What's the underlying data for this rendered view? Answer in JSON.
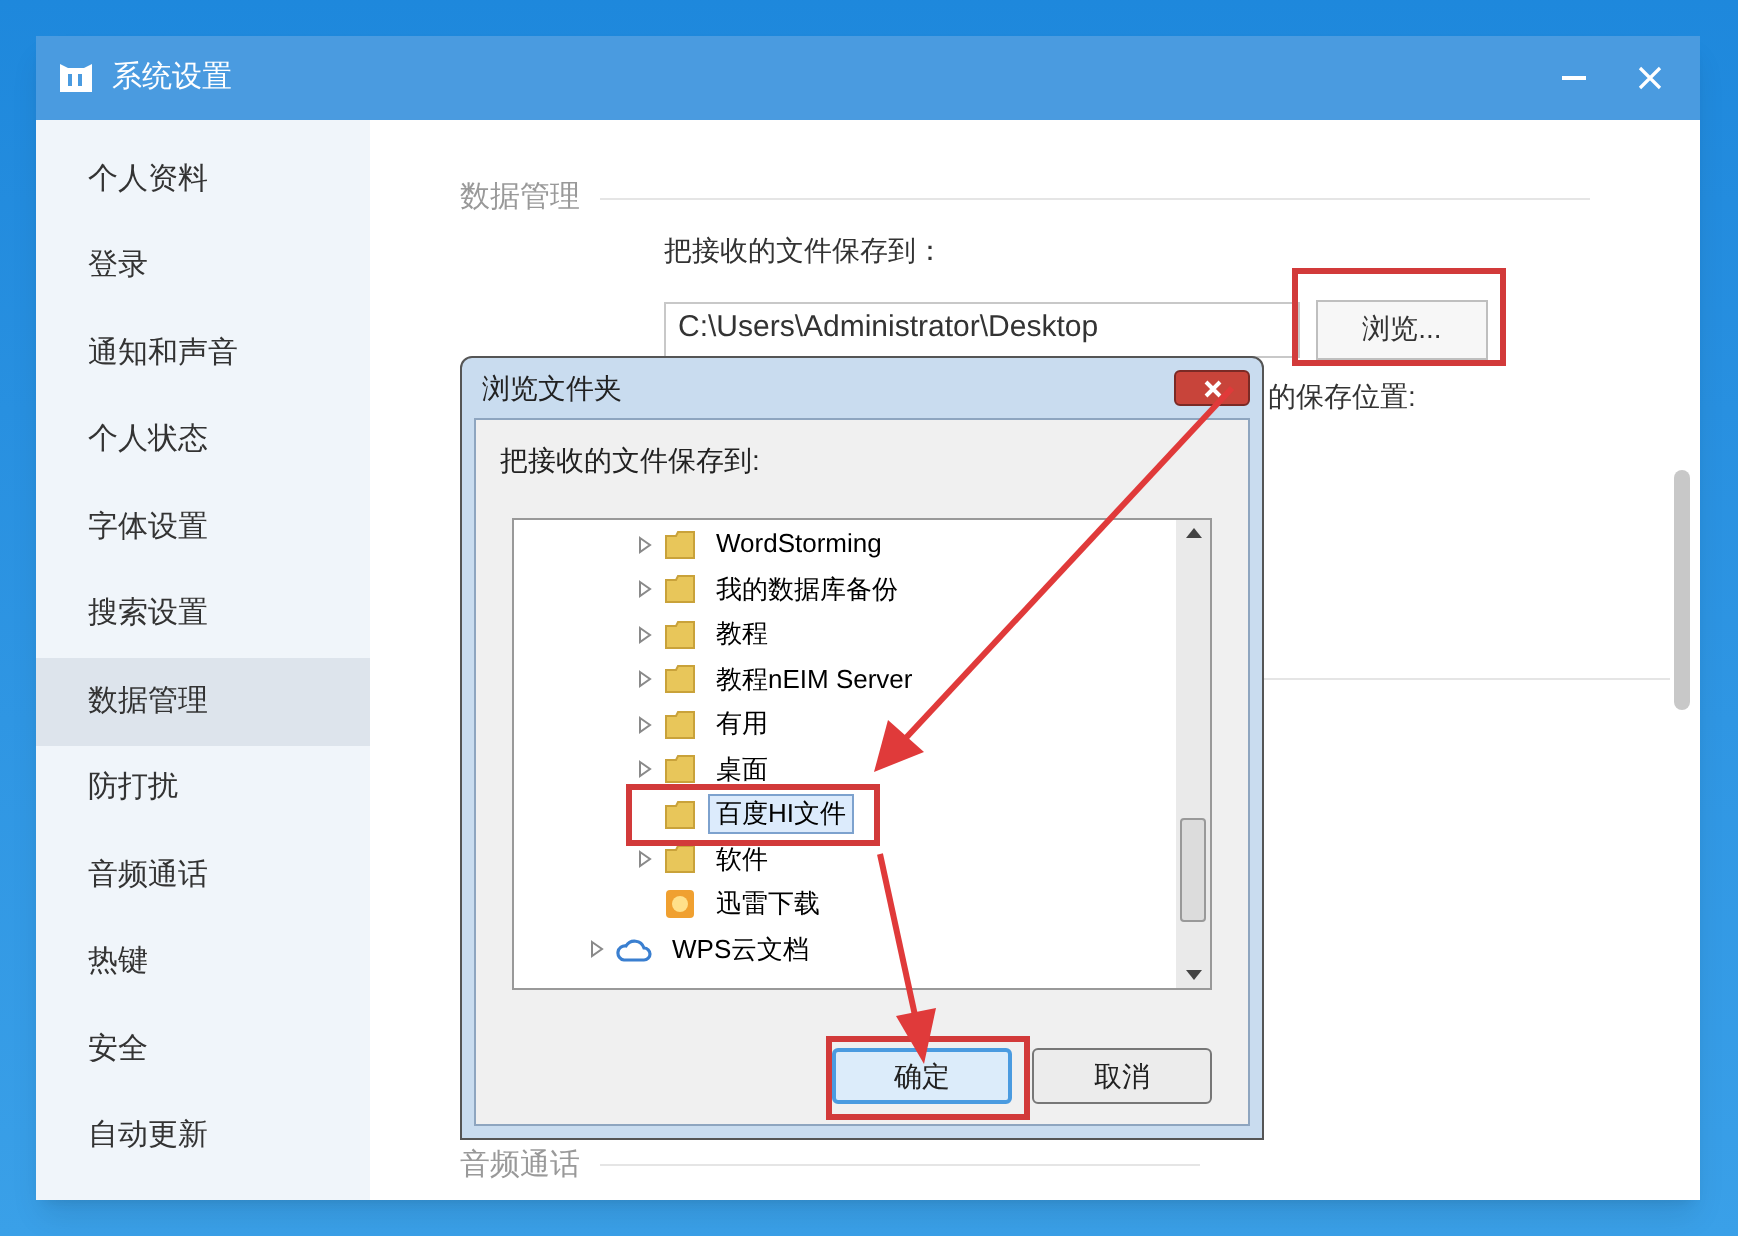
{
  "window": {
    "title": "系统设置"
  },
  "sidebar": {
    "items": [
      {
        "label": "个人资料",
        "selected": false
      },
      {
        "label": "登录",
        "selected": false
      },
      {
        "label": "通知和声音",
        "selected": false
      },
      {
        "label": "个人状态",
        "selected": false
      },
      {
        "label": "字体设置",
        "selected": false
      },
      {
        "label": "搜索设置",
        "selected": false
      },
      {
        "label": "数据管理",
        "selected": true
      },
      {
        "label": "防打扰",
        "selected": false
      },
      {
        "label": "音频通话",
        "selected": false
      },
      {
        "label": "热键",
        "selected": false
      },
      {
        "label": "安全",
        "selected": false
      },
      {
        "label": "自动更新",
        "selected": false
      }
    ]
  },
  "content": {
    "section_title": "数据管理",
    "save_label": "把接收的文件保存到：",
    "path_field": {
      "value": "C:\\Users\\Administrator\\Desktop"
    },
    "browse_button": "浏览...",
    "hidden_text_fragment": "的保存位置:",
    "next_section_title": "音频通话"
  },
  "dialog": {
    "title": "浏览文件夹",
    "prompt": "把接收的文件保存到:",
    "tree": {
      "subfolders": [
        {
          "label": "WordStorming",
          "kind": "folder",
          "expandable": true,
          "selected": false
        },
        {
          "label": "我的数据库备份",
          "kind": "folder",
          "expandable": true,
          "selected": false
        },
        {
          "label": "教程",
          "kind": "folder",
          "expandable": true,
          "selected": false
        },
        {
          "label": "教程nEIM Server",
          "kind": "folder",
          "expandable": true,
          "selected": false
        },
        {
          "label": "有用",
          "kind": "folder",
          "expandable": true,
          "selected": false
        },
        {
          "label": "桌面",
          "kind": "folder",
          "expandable": true,
          "selected": false
        },
        {
          "label": "百度HI文件",
          "kind": "folder",
          "expandable": false,
          "selected": true
        },
        {
          "label": "软件",
          "kind": "folder",
          "expandable": true,
          "selected": false
        },
        {
          "label": "迅雷下载",
          "kind": "download",
          "expandable": false,
          "selected": false
        }
      ],
      "top_level": [
        {
          "label": "WPS云文档",
          "kind": "cloud",
          "expandable": true,
          "selected": false
        }
      ]
    },
    "buttons": [
      {
        "label": "确定",
        "default": true
      },
      {
        "label": "取消",
        "default": false
      }
    ]
  }
}
